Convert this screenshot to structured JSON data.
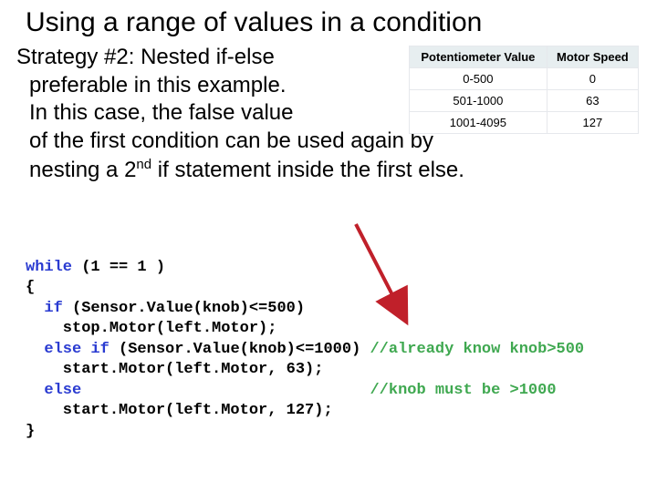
{
  "title": "Using a range of values in a condition",
  "body": {
    "line1": "Strategy #2: Nested if-else",
    "line2": "preferable in this example.",
    "line3": "In this case, the false value",
    "line4": "of the first condition can be used again by",
    "line5a": "nesting a 2",
    "line5sup": "nd",
    "line5b": " if statement inside the first else."
  },
  "table": {
    "headers": [
      "Potentiometer Value",
      "Motor Speed"
    ],
    "rows": [
      {
        "range": "0-500",
        "speed": "0"
      },
      {
        "range": "501-1000",
        "speed": "63"
      },
      {
        "range": "1001-4095",
        "speed": "127"
      }
    ]
  },
  "code": {
    "kw_while": "while",
    "w_cond": " (1 == 1 )",
    "brace_open": "{",
    "kw_if": "if",
    "if_cond": " (Sensor.Value(knob)<=500)",
    "stop": "    stop.Motor(left.Motor);",
    "kw_elseif": "else if",
    "elseif_cond": " (Sensor.Value(knob)<=1000) ",
    "cm1": "//already know knob>500",
    "start63": "    start.Motor(left.Motor, 63);",
    "kw_else": "else",
    "else_pad": "                               ",
    "cm2": "//knob must be >1000",
    "start127": "    start.Motor(left.Motor, 127);",
    "brace_close": "}"
  },
  "chart_data": {
    "type": "table",
    "title": "Potentiometer value to motor speed mapping",
    "columns": [
      "Potentiometer Value",
      "Motor Speed"
    ],
    "rows": [
      [
        "0-500",
        0
      ],
      [
        "501-1000",
        63
      ],
      [
        "1001-4095",
        127
      ]
    ]
  }
}
